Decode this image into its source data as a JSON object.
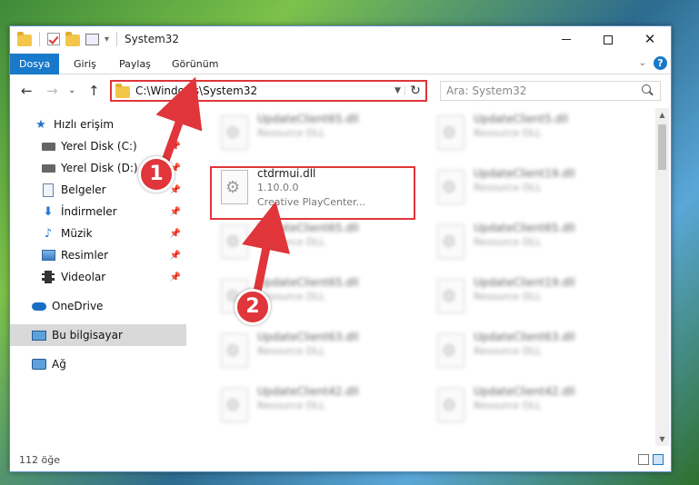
{
  "window": {
    "title": "System32"
  },
  "ribbon": {
    "tabs": [
      {
        "label": "Dosya",
        "active": true
      },
      {
        "label": "Giriş"
      },
      {
        "label": "Paylaş"
      },
      {
        "label": "Görünüm"
      }
    ],
    "help": "?"
  },
  "address": {
    "path": "C:\\Windows\\System32",
    "search_placeholder": "Ara: System32"
  },
  "sidebar": {
    "items": [
      {
        "label": "Hızlı erişim",
        "icon": "star-icon"
      },
      {
        "label": "Yerel Disk (C:)",
        "icon": "disk-icon",
        "pinned": true
      },
      {
        "label": "Yerel Disk (D:)",
        "icon": "disk-icon",
        "pinned": true
      },
      {
        "label": "Belgeler",
        "icon": "document-icon",
        "pinned": true
      },
      {
        "label": "İndirmeler",
        "icon": "download-icon",
        "pinned": true
      },
      {
        "label": "Müzik",
        "icon": "music-icon",
        "pinned": true
      },
      {
        "label": "Resimler",
        "icon": "pictures-icon",
        "pinned": true
      },
      {
        "label": "Videolar",
        "icon": "video-icon",
        "pinned": true
      },
      {
        "label": "OneDrive",
        "icon": "cloud-icon"
      },
      {
        "label": "Bu bilgisayar",
        "icon": "computer-icon",
        "selected": true
      },
      {
        "label": "Ağ",
        "icon": "network-icon"
      }
    ]
  },
  "files": {
    "left": [
      {
        "name": "UpdateClient65.dll",
        "meta": "Resource DLL",
        "blurred": true
      },
      {
        "name": "ctdrmui.dll",
        "version": "1.10.0.0",
        "desc": "Creative PlayCenter...",
        "blurred": false
      },
      {
        "name": "UpdateClient65.dll",
        "meta": "Resource DLL",
        "blurred": true
      },
      {
        "name": "UpdateClient65.dll",
        "meta": "Resource DLL",
        "blurred": true
      },
      {
        "name": "UpdateClient63.dll",
        "meta": "Resource DLL",
        "blurred": true
      },
      {
        "name": "UpdateClient42.dll",
        "meta": "Resource DLL",
        "blurred": true
      }
    ],
    "right": [
      {
        "name": "UpdateClient5.dll",
        "meta": "Resource DLL"
      },
      {
        "name": "UpdateClient19.dll",
        "meta": "Resource DLL"
      },
      {
        "name": "UpdateClient65.dll",
        "meta": "Resource DLL"
      },
      {
        "name": "UpdateClient19.dll",
        "meta": "Resource DLL"
      },
      {
        "name": "UpdateClient63.dll",
        "meta": "Resource DLL"
      },
      {
        "name": "UpdateClient42.dll",
        "meta": "Resource DLL"
      }
    ]
  },
  "status": {
    "count": "112 öğe"
  },
  "annotations": {
    "step1": "1",
    "step2": "2",
    "color": "#e0353a"
  }
}
